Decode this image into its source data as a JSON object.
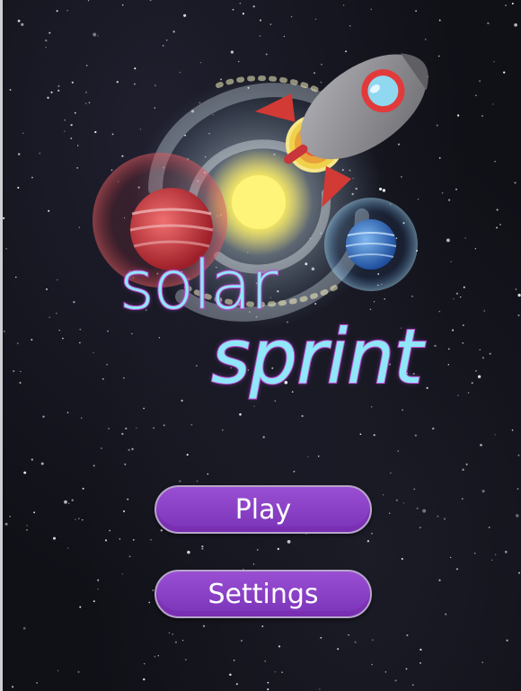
{
  "screen": {
    "name": "main-menu"
  },
  "title": {
    "line1": "solar",
    "line2": "sprint",
    "text_color": "#8fe7f7",
    "outline_color": "#c24fd0"
  },
  "menu": {
    "play_label": "Play",
    "settings_label": "Settings",
    "button_color": "#8a42c6"
  },
  "art": {
    "icons": [
      "galaxy-swirl-icon",
      "sun-icon",
      "red-planet-icon",
      "blue-planet-icon",
      "ringed-planet-icon",
      "rocket-icon"
    ],
    "colors": {
      "sun": "#ffef5a",
      "red_planet": "#c8353a",
      "blue_planet": "#3a7fd0",
      "rocket_body": "#8f8f94",
      "rocket_fin": "#d23a35",
      "rocket_window": "#8fd8f0"
    }
  }
}
